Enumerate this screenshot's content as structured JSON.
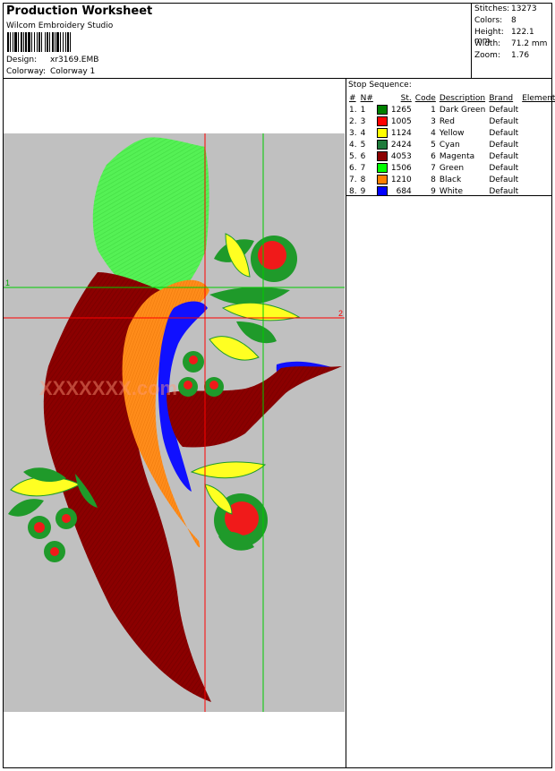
{
  "header": {
    "title": "Production Worksheet",
    "subtitle": "Wilcom Embroidery Studio",
    "design_label": "Design:",
    "design_value": "xr3169.EMB",
    "colorway_label": "Colorway:",
    "colorway_value": "Colorway 1"
  },
  "stats": [
    {
      "label": "Stitches:",
      "value": "13273"
    },
    {
      "label": "Colors:",
      "value": "8"
    },
    {
      "label": "Height:",
      "value": "122.1 mm"
    },
    {
      "label": "Width:",
      "value": "71.2 mm"
    },
    {
      "label": "Zoom:",
      "value": "1.76"
    }
  ],
  "stop_sequence": {
    "title": "Stop Sequence:",
    "columns": [
      "#",
      "N#",
      "St.",
      "Code",
      "Description",
      "Brand",
      "Element"
    ],
    "rows": [
      {
        "idx": "1.",
        "n": "1",
        "color": "#008000",
        "st": "1265",
        "code": "1",
        "desc": "Dark Green",
        "brand": "Default",
        "element": ""
      },
      {
        "idx": "2.",
        "n": "3",
        "color": "#ff0000",
        "st": "1005",
        "code": "3",
        "desc": "Red",
        "brand": "Default",
        "element": ""
      },
      {
        "idx": "3.",
        "n": "4",
        "color": "#ffff00",
        "st": "1124",
        "code": "4",
        "desc": "Yellow",
        "brand": "Default",
        "element": ""
      },
      {
        "idx": "4.",
        "n": "5",
        "color": "#1e7a3a",
        "st": "2424",
        "code": "5",
        "desc": "Cyan",
        "brand": "Default",
        "element": ""
      },
      {
        "idx": "5.",
        "n": "6",
        "color": "#8b0000",
        "st": "4053",
        "code": "6",
        "desc": "Magenta",
        "brand": "Default",
        "element": ""
      },
      {
        "idx": "6.",
        "n": "7",
        "color": "#00ff00",
        "st": "1506",
        "code": "7",
        "desc": "Green",
        "brand": "Default",
        "element": ""
      },
      {
        "idx": "7.",
        "n": "8",
        "color": "#ff8000",
        "st": "1210",
        "code": "8",
        "desc": "Black",
        "brand": "Default",
        "element": ""
      },
      {
        "idx": "8.",
        "n": "9",
        "color": "#0000ff",
        "st": "684",
        "code": "9",
        "desc": "White",
        "brand": "Default",
        "element": ""
      }
    ]
  },
  "guides": {
    "marker_1": "1",
    "marker_2": "2",
    "guide_color_green": "#00cc00",
    "guide_color_red": "#ff0000"
  },
  "watermark": "XXXXXXX.com"
}
